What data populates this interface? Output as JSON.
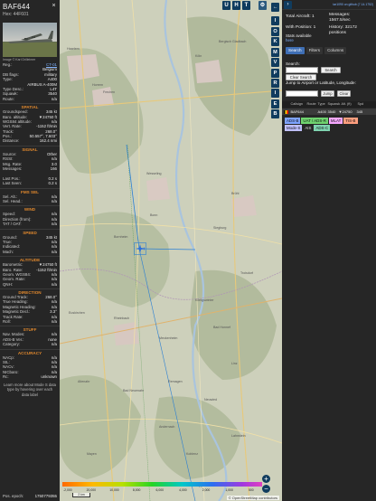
{
  "aircraft": {
    "callsign": "BAF644",
    "hex_line": "Hex:  44F601",
    "photo_credit": "Image © Karl Drilleimer"
  },
  "details": [
    {
      "k": "Reg.:",
      "v": "CT-01",
      "link": true
    },
    {
      "k": "",
      "v": "Belgium"
    },
    {
      "k": "DB flags:",
      "v": "military"
    },
    {
      "k": "Type:",
      "v": "A400"
    },
    {
      "k": "",
      "v": "AIRBUS A-400M"
    },
    {
      "k": "Type Desc.:",
      "v": "L4T"
    },
    {
      "k": "Squawk:",
      "v": "3540"
    },
    {
      "k": "Route:",
      "v": "n/a"
    }
  ],
  "sections": [
    {
      "title": "SPATIAL",
      "rows": [
        {
          "k": "Groundspeed:",
          "v": "345 kt"
        },
        {
          "k": "Baro. altitude:",
          "v": "▼24750 ft"
        },
        {
          "k": "WGS84 altitude:",
          "v": "n/a"
        },
        {
          "k": "Vert. Rate:",
          "v": "-1152 ft/min"
        },
        {
          "k": "Track:",
          "v": "268.0°"
        },
        {
          "k": "Pos.:",
          "v": "50.557°, 7.603°"
        },
        {
          "k": "Distance:",
          "v": "162.4 nmi"
        }
      ]
    },
    {
      "title": "SIGNAL",
      "rows": [
        {
          "k": "Source:",
          "v": "Other"
        },
        {
          "k": "RSSI:",
          "v": "n/a"
        },
        {
          "k": "Msg. Rate:",
          "v": "3.0"
        },
        {
          "k": "Messages:",
          "v": "166"
        },
        {
          "k": "",
          "v": ""
        },
        {
          "k": "Last Pos.:",
          "v": "0.2 s"
        },
        {
          "k": "Last Seen:",
          "v": "0.2 s"
        }
      ]
    },
    {
      "title": "FMS SEL",
      "rows": [
        {
          "k": "Sel. Alt.:",
          "v": "n/a"
        },
        {
          "k": "Sel. Head.:",
          "v": "n/a"
        }
      ]
    },
    {
      "title": "WIND",
      "rows": [
        {
          "k": "Speed:",
          "v": "n/a"
        },
        {
          "k": "Direction (from):",
          "v": "n/a"
        },
        {
          "k": "TAT / OAT:",
          "v": "n/a"
        }
      ]
    },
    {
      "title": "SPEED",
      "rows": [
        {
          "k": "Ground:",
          "v": "345 kt"
        },
        {
          "k": "True:",
          "v": "n/a"
        },
        {
          "k": "Indicated:",
          "v": "n/a"
        },
        {
          "k": "Mach:",
          "v": "n/a"
        }
      ]
    },
    {
      "title": "ALTITUDE",
      "rows": [
        {
          "k": "Barometric:",
          "v": "▼24750 ft"
        },
        {
          "k": "Baro. Rate:",
          "v": "-1152 ft/min"
        },
        {
          "k": "Geom. WGS84:",
          "v": "n/a"
        },
        {
          "k": "Geom. Rate:",
          "v": "n/a"
        },
        {
          "k": "QNH:",
          "v": "n/a"
        }
      ]
    },
    {
      "title": "DIRECTION",
      "rows": [
        {
          "k": "Ground Track:",
          "v": "268.0°"
        },
        {
          "k": "True Heading:",
          "v": "n/a"
        },
        {
          "k": "Magnetic Heading:",
          "v": "n/a"
        },
        {
          "k": "Magnetic Decl.:",
          "v": "3.3°"
        },
        {
          "k": "Track Rate:",
          "v": "n/a"
        },
        {
          "k": "Roll:",
          "v": "n/a"
        }
      ]
    },
    {
      "title": "STUFF",
      "rows": [
        {
          "k": "Nav. Modes:",
          "v": "n/a"
        },
        {
          "k": "ADS-B Ver.:",
          "v": "none"
        },
        {
          "k": "Category:",
          "v": "n/a"
        }
      ]
    },
    {
      "title": "ACCURACY",
      "rows": [
        {
          "k": "NACp:",
          "v": "n/a"
        },
        {
          "k": "SIL:",
          "v": "n/a"
        },
        {
          "k": "NACv:",
          "v": "n/a"
        },
        {
          "k": "NICbaro:",
          "v": "n/a"
        },
        {
          "k": "Rc:",
          "v": "unknown"
        }
      ]
    }
  ],
  "info_text": "Learn more about Mode S data type by hovering over each data label",
  "footer": {
    "k": "Pos. epoch:",
    "v": "1750779355"
  },
  "map": {
    "top_buttons": [
      "U",
      "H",
      "T"
    ],
    "zoom_in": "+",
    "zoom_out": "−",
    "scale_ticks": [
      "-2,000",
      "20,000",
      "10,000",
      "8,000",
      "6,000",
      "4,000",
      "2,000",
      "1,000",
      "500"
    ],
    "scale_box": "2 km",
    "attribution": "© OpenStreetMap contributors",
    "places": [
      "Haarlem",
      "Horrem",
      "Frechen",
      "Köln",
      "Bergisch Gladbach",
      "Wesseling",
      "Brühl",
      "Bornheim",
      "Bonn",
      "Siegburg",
      "Troisdorf",
      "Euskirchen",
      "Rheinbach",
      "Meckenheim",
      "Bad Honnef",
      "Königswinter",
      "Linz",
      "Remagen",
      "Bad Neuenahr",
      "Altenahr",
      "Mayen",
      "Andernach",
      "Neuwied",
      "Koblenz",
      "Lahnstein",
      "Boppard"
    ],
    "colors": {
      "track_line": "#2a7fd4",
      "aircraft": "#2a6fdc",
      "selected_outline": "#2a7fd4"
    }
  },
  "vbar_buttons": [
    "←",
    "I",
    "O",
    "K",
    "M",
    "V",
    "P",
    "R",
    "I",
    "E",
    "B"
  ],
  "right": {
    "version": "tar1090 on github (7.14.1752)",
    "total_aircraft": "Total Aircraft: 1",
    "with_position": "With Position: 1",
    "stats_available": "Stats available",
    "stats_link": "here",
    "messages": "Messages:",
    "messages_rate": "1567.5/sec",
    "history": "History: 32172",
    "history2": "positions",
    "tabs": [
      "Search",
      "Filters",
      "Columns"
    ],
    "search_label": "Search:",
    "search_button": "Search",
    "clear_search": "Clear Search",
    "jump_label": "Jump to Airport or Latitude, Longitude:",
    "jump_button": "Jump",
    "clear_button": "Clear",
    "columns": [
      "Callsign",
      "Route",
      "Type",
      "Squawk",
      "Alt. (ft)",
      "Spd"
    ],
    "row": {
      "callsign": "BAF644",
      "route": "",
      "type": "A400",
      "squawk": "3540",
      "alt": "▼24750",
      "spd": "345"
    },
    "legend": [
      {
        "label": "ADS-B",
        "color": "#7ea3ff"
      },
      {
        "label": "UAT / ADS-R",
        "color": "#6fd36f"
      },
      {
        "label": "MLAT",
        "color": "#f7a8ff"
      },
      {
        "label": "TIS-B",
        "color": "#ff9f7f"
      },
      {
        "label": "Mode-S",
        "color": "#bfbfff"
      },
      {
        "label": "AIS",
        "color": "#262626",
        "text_color": "#ddd"
      },
      {
        "label": "ADS-C",
        "color": "#7fd3b0"
      }
    ]
  }
}
